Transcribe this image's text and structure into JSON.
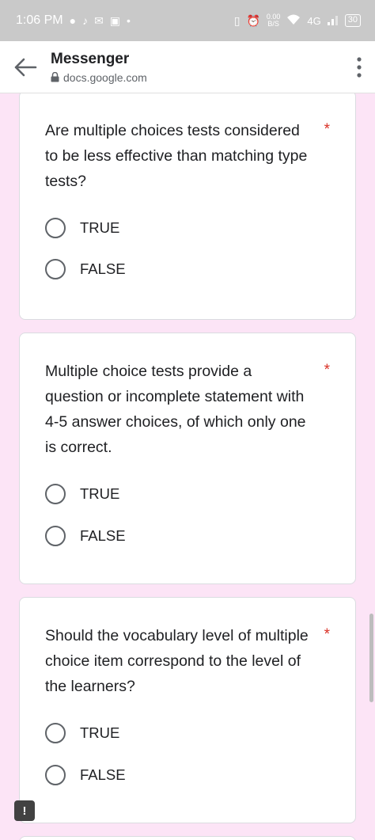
{
  "status_bar": {
    "time": "1:06 PM",
    "speed_value": "0.00",
    "speed_unit": "B/S",
    "network": "4G",
    "battery": "30"
  },
  "app_bar": {
    "title": "Messenger",
    "url": "docs.google.com"
  },
  "questions": [
    {
      "text": "Are multiple choices tests considered to be less effective than matching type tests?",
      "required_mark": "*",
      "options": [
        "TRUE",
        "FALSE"
      ]
    },
    {
      "text": "Multiple choice tests provide a question or incomplete statement with 4-5 answer choices, of which only one is correct.",
      "required_mark": "*",
      "options": [
        "TRUE",
        "FALSE"
      ]
    },
    {
      "text": "Should the vocabulary level of multiple choice item correspond to the level of the learners?",
      "required_mark": "*",
      "options": [
        "TRUE",
        "FALSE"
      ]
    }
  ],
  "report_button": {
    "label": "!"
  }
}
